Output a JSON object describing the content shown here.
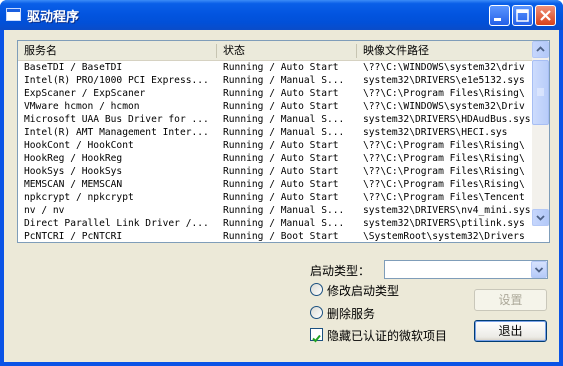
{
  "window": {
    "title": "驱动程序"
  },
  "list": {
    "columns": [
      "服务名",
      "状态",
      "映像文件路径"
    ],
    "rows": [
      [
        "BaseTDI / BaseTDI",
        "Running / Auto Start",
        "\\??\\C:\\WINDOWS\\system32\\driv"
      ],
      [
        "Intel(R) PRO/1000 PCI Express...",
        "Running / Manual S...",
        "system32\\DRIVERS\\e1e5132.sys"
      ],
      [
        "ExpScaner / ExpScaner",
        "Running / Auto Start",
        "\\??\\C:\\Program Files\\Rising\\"
      ],
      [
        "VMware hcmon / hcmon",
        "Running / Auto Start",
        "\\??\\C:\\WINDOWS\\system32\\Driv"
      ],
      [
        "Microsoft UAA Bus Driver for ...",
        "Running / Manual S...",
        "system32\\DRIVERS\\HDAudBus.sys"
      ],
      [
        "Intel(R) AMT Management Inter...",
        "Running / Manual S...",
        "system32\\DRIVERS\\HECI.sys"
      ],
      [
        "HookCont / HookCont",
        "Running / Auto Start",
        "\\??\\C:\\Program Files\\Rising\\"
      ],
      [
        "HookReg / HookReg",
        "Running / Auto Start",
        "\\??\\C:\\Program Files\\Rising\\"
      ],
      [
        "HookSys / HookSys",
        "Running / Auto Start",
        "\\??\\C:\\Program Files\\Rising\\"
      ],
      [
        "MEMSCAN / MEMSCAN",
        "Running / Auto Start",
        "\\??\\C:\\Program Files\\Rising\\"
      ],
      [
        "npkcrypt / npkcrypt",
        "Running / Auto Start",
        "\\??\\C:\\Program Files\\Tencent"
      ],
      [
        "nv / nv",
        "Running / Manual S...",
        "system32\\DRIVERS\\nv4_mini.sys"
      ],
      [
        "Direct Parallel Link Driver /...",
        "Running / Manual S...",
        "system32\\DRIVERS\\ptilink.sys"
      ],
      [
        "PcNTCRI / PcNTCRI",
        "Running / Boot Start",
        "\\SystemRoot\\system32\\Drivers"
      ]
    ]
  },
  "controls": {
    "start_type_label": "启动类型：",
    "combo_value": "",
    "radio_modify": "修改启动类型",
    "radio_delete": "删除服务",
    "checkbox_hide": "隐藏已认证的微软项目",
    "checkbox_hide_checked": true,
    "settings_button": "设置",
    "exit_button": "退出"
  }
}
